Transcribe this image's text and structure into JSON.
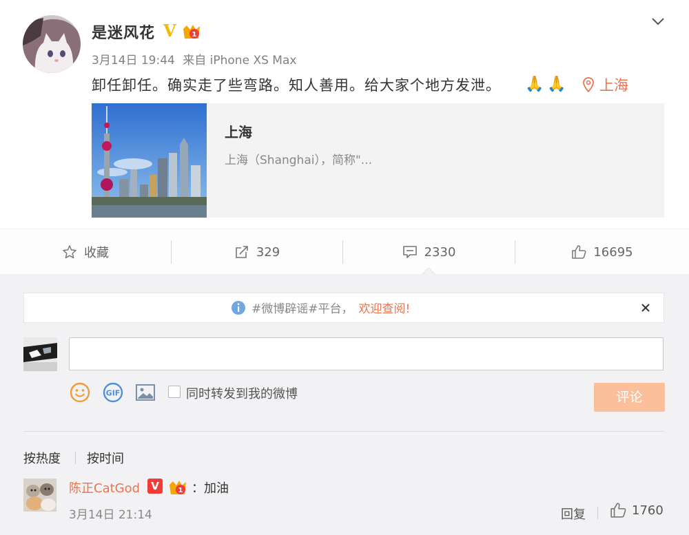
{
  "post": {
    "username": "是迷风花",
    "verified_badge": "V",
    "crown_label": "1",
    "date": "3月14日 19:44",
    "source": "来自 iPhone XS Max",
    "text": "卸任卸任。确实走了些弯路。知人善用。给大家个地方发泄。",
    "emoji": "🙏",
    "location": "上海",
    "card": {
      "title": "上海",
      "description": "上海（Shanghai），简称\"..."
    },
    "icons": {
      "avatar": "cat-avatar-photo",
      "more": "chevron-down-icon",
      "location": "map-pin-icon"
    }
  },
  "actions": {
    "favorite_label": "收藏",
    "repost_count": "329",
    "comment_count": "2330",
    "like_count": "16695"
  },
  "comments_section": {
    "notice": {
      "text": "#微博辟谣#平台，",
      "link": "欢迎查阅!"
    },
    "input": {
      "value": "",
      "placeholder": ""
    },
    "repost_checkbox_label": "同时转发到我的微博",
    "submit_label": "评论",
    "sort_hot": "按热度",
    "sort_time": "按时间",
    "tool_icons": [
      "emoji-icon",
      "gif-icon",
      "image-icon"
    ],
    "comments": [
      {
        "username": "陈正CatGod",
        "badge": "V",
        "crown_label": "1",
        "text": "：加油",
        "time": "3月14日 21:14",
        "reply_label": "回复",
        "like_count": "1760"
      }
    ]
  },
  "colors": {
    "accent": "#eb7350",
    "verified_gold": "#f7b800",
    "verified_red": "#f53a3a",
    "submit_disabled": "#fbbf9b",
    "comment_bg": "#f2f2f5",
    "card_bg": "#f3f3f3"
  }
}
